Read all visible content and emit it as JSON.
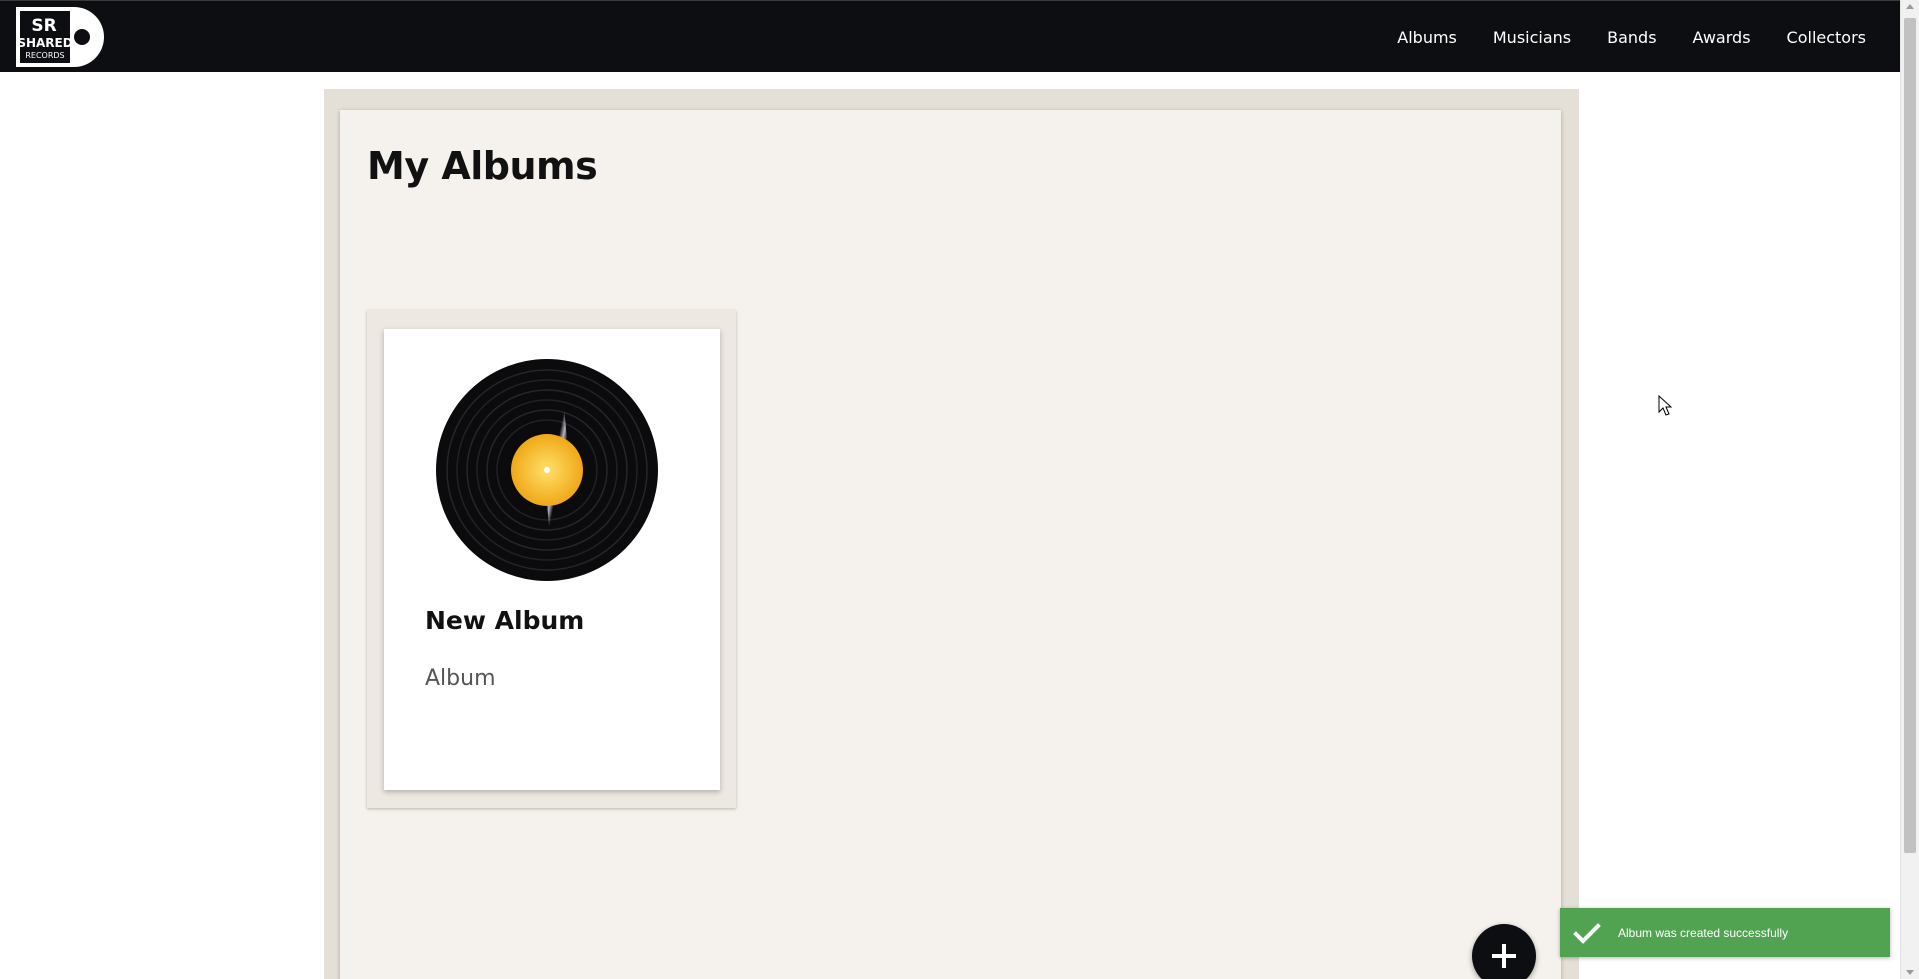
{
  "brand": {
    "logo_text_1": "SR",
    "logo_text_2": "SHARED",
    "logo_text_3": "RECORDS"
  },
  "nav": {
    "items": [
      {
        "label": "Albums"
      },
      {
        "label": "Musicians"
      },
      {
        "label": "Bands"
      },
      {
        "label": "Awards"
      },
      {
        "label": "Collectors"
      }
    ]
  },
  "main": {
    "title": "My Albums",
    "albums": [
      {
        "title": "New Album",
        "type": "Album",
        "cover_icon": "vinyl-record"
      }
    ]
  },
  "actions": {
    "add_icon": "plus-icon"
  },
  "toast": {
    "message": "Album was created successfully",
    "icon": "check-icon",
    "color": "#51a351"
  },
  "colors": {
    "navbar": "#0c0e12",
    "panel": "#f5f1ec",
    "label_yellow": "#f6b820"
  }
}
